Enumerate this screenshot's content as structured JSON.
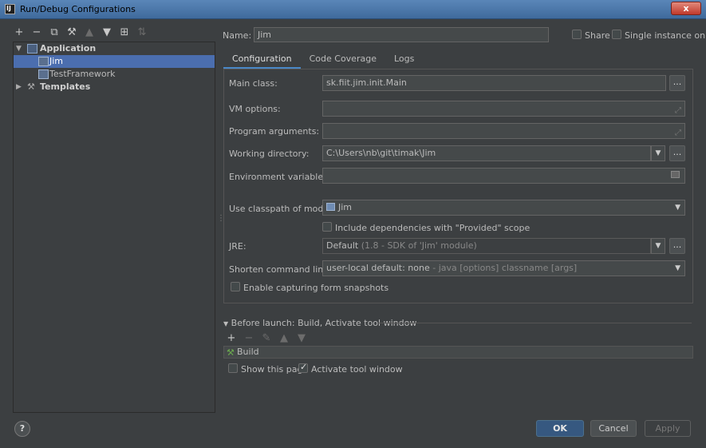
{
  "window": {
    "title": "Run/Debug Configurations",
    "close_label": "x"
  },
  "toolbar": {
    "icons": [
      "add-icon",
      "remove-icon",
      "copy-icon",
      "edit-defaults-icon",
      "move-up-icon",
      "move-down-icon",
      "new-folder-icon",
      "sort-icon"
    ],
    "glyphs": {
      "add": "+",
      "remove": "−",
      "copy": "⧉",
      "wrench": "🔧",
      "up": "▲",
      "down": "▼",
      "folder": "⊞",
      "sort": "⇅"
    }
  },
  "tree": {
    "items": [
      {
        "label": "Application",
        "expanded": true
      },
      {
        "label": "Jim",
        "selected": true
      },
      {
        "label": "TestFramework"
      },
      {
        "label": "Templates",
        "expanded": false
      }
    ]
  },
  "form": {
    "name_label": "Name:",
    "name_value": "Jim",
    "share_label": "Share",
    "single_instance_label": "Single instance only",
    "tabs": [
      "Configuration",
      "Code Coverage",
      "Logs"
    ],
    "main_class_label": "Main class:",
    "main_class_value": "sk.fiit.jim.init.Main",
    "vm_options_label": "VM options:",
    "vm_options_value": "",
    "program_args_label": "Program arguments:",
    "program_args_value": "",
    "working_dir_label": "Working directory:",
    "working_dir_value": "C:\\Users\\nb\\git\\timak\\Jim",
    "env_vars_label": "Environment variables:",
    "env_vars_value": "",
    "classpath_label": "Use classpath of module:",
    "classpath_value": "Jim",
    "include_deps_label": "Include dependencies with \"Provided\" scope",
    "jre_label": "JRE:",
    "jre_value": "Default",
    "jre_hint": "(1.8 - SDK of 'Jim' module)",
    "shorten_label": "Shorten command line:",
    "shorten_value": "user-local default: none",
    "shorten_hint": " - java [options] classname [args]",
    "snapshots_label": "Enable capturing form snapshots",
    "dots": "..."
  },
  "before_launch": {
    "header": "Before launch: Build, Activate tool window",
    "items": [
      "Build"
    ],
    "show_page_label": "Show this page",
    "activate_label": "Activate tool window"
  },
  "buttons": {
    "help": "?",
    "ok": "OK",
    "cancel": "Cancel",
    "apply": "Apply"
  }
}
